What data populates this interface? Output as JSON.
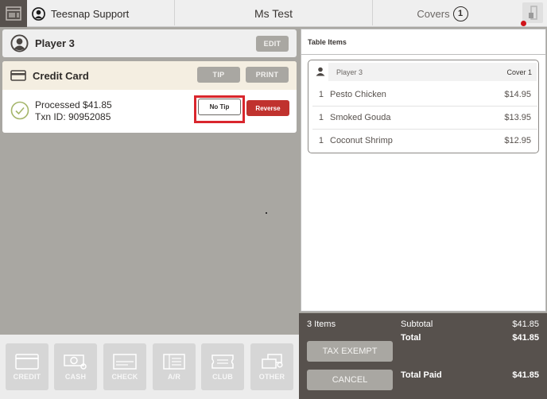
{
  "topbar": {
    "user_name": "Teesnap Support",
    "table_name": "Ms Test",
    "covers_label": "Covers",
    "covers_count": "1",
    "status_color": "#d0131a"
  },
  "player": {
    "name": "Player 3",
    "edit_label": "EDIT"
  },
  "payment": {
    "method": "Credit Card",
    "tip_label": "TIP",
    "print_label": "PRINT",
    "processed_text": "Processed $41.85",
    "txn_text": "Txn ID: 90952085",
    "no_tip_label": "No Tip",
    "reverse_label": "Reverse",
    "highlight_color": "#d9262d"
  },
  "tenders": [
    {
      "label": "CREDIT",
      "icon": "credit-card-icon"
    },
    {
      "label": "CASH",
      "icon": "cash-icon"
    },
    {
      "label": "CHECK",
      "icon": "check-icon"
    },
    {
      "label": "A/R",
      "icon": "ar-ledger-icon"
    },
    {
      "label": "CLUB",
      "icon": "club-ticket-icon"
    },
    {
      "label": "OTHER",
      "icon": "other-cards-icon"
    }
  ],
  "table_items": {
    "title": "Table Items",
    "player": "Player 3",
    "cover": "Cover 1",
    "items": [
      {
        "qty": "1",
        "name": "Pesto Chicken",
        "price": "$14.95"
      },
      {
        "qty": "1",
        "name": "Smoked Gouda",
        "price": "$13.95"
      },
      {
        "qty": "1",
        "name": "Coconut Shrimp",
        "price": "$12.95"
      }
    ]
  },
  "totals": {
    "item_count": "3 Items",
    "tax_exempt_label": "TAX EXEMPT",
    "cancel_label": "CANCEL",
    "subtotal_label": "Subtotal",
    "subtotal_value": "$41.85",
    "total_label": "Total",
    "total_value": "$41.85",
    "total_paid_label": "Total Paid",
    "total_paid_value": "$41.85"
  }
}
